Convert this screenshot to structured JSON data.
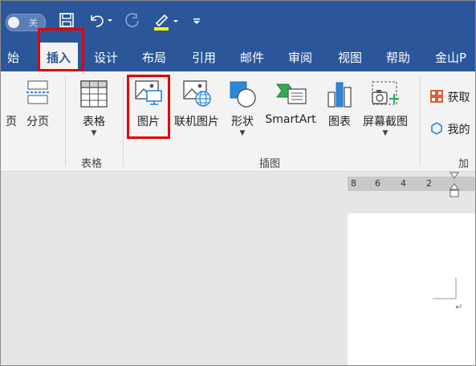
{
  "titlebar": {
    "toggle_label": "关"
  },
  "tabs": [
    "始",
    "插入",
    "设计",
    "布局",
    "引用",
    "邮件",
    "审阅",
    "视图",
    "帮助",
    "金山P"
  ],
  "ribbon": {
    "page_break": "分页",
    "page_prefix": "页",
    "table": "表格",
    "picture": "图片",
    "online_picture": "联机图片",
    "shapes": "形状",
    "smartart": "SmartArt",
    "chart": "图表",
    "screenshot": "屏幕截图",
    "get_addins": "获取",
    "my_addins": "我的",
    "group_tables": "表格",
    "group_illustrations": "插图",
    "group_addins": "加"
  },
  "ruler": [
    "8",
    "6",
    "4",
    "2"
  ],
  "page": {
    "paragraph_mark": "↵"
  },
  "colors": {
    "title_bar": "#2b579a",
    "highlight_box": "#e10000"
  }
}
